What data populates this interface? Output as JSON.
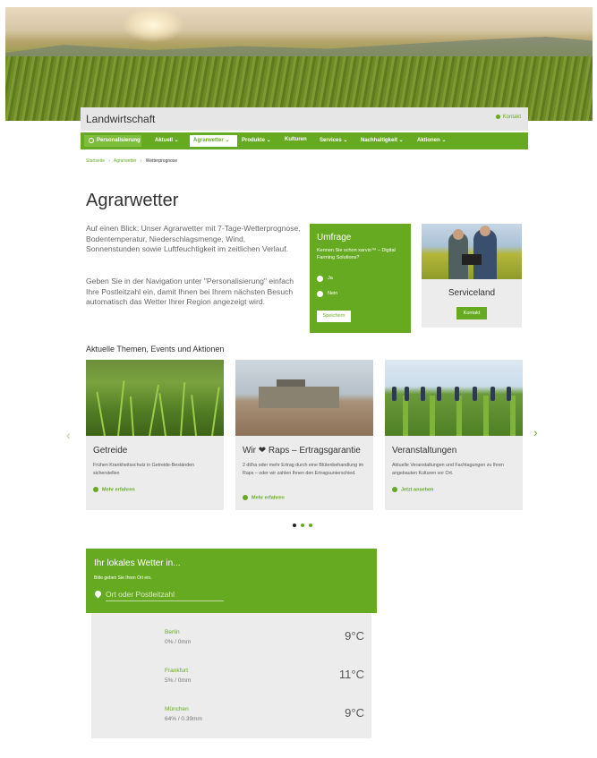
{
  "header": {
    "brand": "Landwirtschaft",
    "contact": "Kontakt"
  },
  "nav": {
    "personalization": "Personalisierung",
    "items": [
      "Aktuell",
      "Agrarwetter",
      "Produkte",
      "Kulturen",
      "Services",
      "Nachhaltigkeit",
      "Aktionen"
    ],
    "active": "Agrarwetter"
  },
  "breadcrumb": {
    "home": "Startseite",
    "parent": "Agrarwetter",
    "current": "Wetterprognose"
  },
  "page": {
    "title": "Agrarwetter",
    "intro": "Auf einen Blick: Unser Agrarwetter mit 7-Tage-Wetterprognose, Bodentemperatur, Niederschlagsmenge, Wind, Sonnenstunden sowie Luftfeuchtigkeit im zeitlichen Verlauf.",
    "intro2": "Geben Sie in der Navigation unter \"Personalisierung\" einfach Ihre Postleitzahl ein, damit Ihnen bei Ihrem nächsten Besuch automatisch das Wetter Ihrer Region angezeigt wird."
  },
  "survey": {
    "title": "Umfrage",
    "question": "Kennen Sie schon xarvio™ – Digital Farming Solutions?",
    "options": [
      "Ja",
      "Nein"
    ],
    "button": "Speichern"
  },
  "service": {
    "label": "Serviceland",
    "button": "Kontakt"
  },
  "section_title": "Aktuelle Themen, Events und Aktionen",
  "cards": [
    {
      "title": "Getreide",
      "desc": "Frühen Krankheitsschutz in Getreide-Beständen sicherstellen",
      "link": "Mehr erfahren"
    },
    {
      "title": "Wir ❤ Raps – Ertragsgarantie",
      "desc": "2 dt/ha oder mehr Ertrag durch eine Blütenbehandlung im Raps – oder wir zahlen Ihnen den Ertragsunterschied.",
      "link": "Mehr erfahren"
    },
    {
      "title": "Veranstaltungen",
      "desc": "Aktuelle Veranstaltungen und Fachtagungen zu Ihren angebauten Kulturen vor Ort.",
      "link": "Jetzt ansehen"
    }
  ],
  "carousel": {
    "prev": "‹",
    "next": "›",
    "active_index": 0,
    "count": 3
  },
  "weather": {
    "title": "Ihr lokales Wetter in...",
    "subtitle": "Bitte geben Sie Ihren Ort ein.",
    "placeholder": "Ort oder Postleitzahl",
    "rows": [
      {
        "city": "Berlin",
        "detail": "0% / 0mm",
        "temp": "9°C"
      },
      {
        "city": "Frankfurt",
        "detail": "5% / 0mm",
        "temp": "11°C"
      },
      {
        "city": "München",
        "detail": "64% / 0.39mm",
        "temp": "9°C"
      }
    ]
  },
  "colors": {
    "accent": "#66aa22",
    "card_bg": "#ececec",
    "header_bg": "#e6e6e6"
  }
}
